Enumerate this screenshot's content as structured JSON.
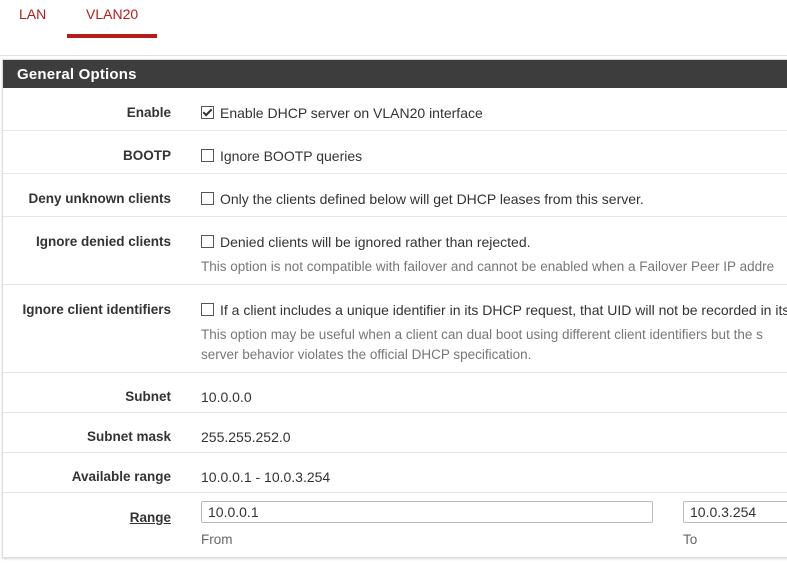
{
  "tabs": [
    {
      "label": "LAN",
      "active": false
    },
    {
      "label": "VLAN20",
      "active": true
    }
  ],
  "colors": {
    "accent": "#b71c1c",
    "panel_heading": "#3d3d3d"
  },
  "panel": {
    "title": "General Options"
  },
  "rows": {
    "enable": {
      "label": "Enable",
      "checked": true,
      "text": "Enable DHCP server on VLAN20 interface"
    },
    "bootp": {
      "label": "BOOTP",
      "checked": false,
      "text": "Ignore BOOTP queries"
    },
    "deny_unknown": {
      "label": "Deny unknown clients",
      "checked": false,
      "text": "Only the clients defined below will get DHCP leases from this server."
    },
    "ignore_denied": {
      "label": "Ignore denied clients",
      "checked": false,
      "text": "Denied clients will be ignored rather than rejected.",
      "help": "This option is not compatible with failover and cannot be enabled when a Failover Peer IP addre"
    },
    "ignore_client_ids": {
      "label": "Ignore client identifiers",
      "checked": false,
      "text": "If a client includes a unique identifier in its DHCP request, that UID will not be recorded in its",
      "help_line1": "This option may be useful when a client can dual boot using different client identifiers but the s",
      "help_line2": "server behavior violates the official DHCP specification."
    },
    "subnet": {
      "label": "Subnet",
      "value": "10.0.0.0"
    },
    "subnet_mask": {
      "label": "Subnet mask",
      "value": "255.255.252.0"
    },
    "available_range": {
      "label": "Available range",
      "value": "10.0.0.1 - 10.0.3.254"
    },
    "range": {
      "label": "Range",
      "from_value": "10.0.0.1",
      "from_label": "From",
      "to_value": "10.0.3.254",
      "to_label": "To"
    }
  }
}
